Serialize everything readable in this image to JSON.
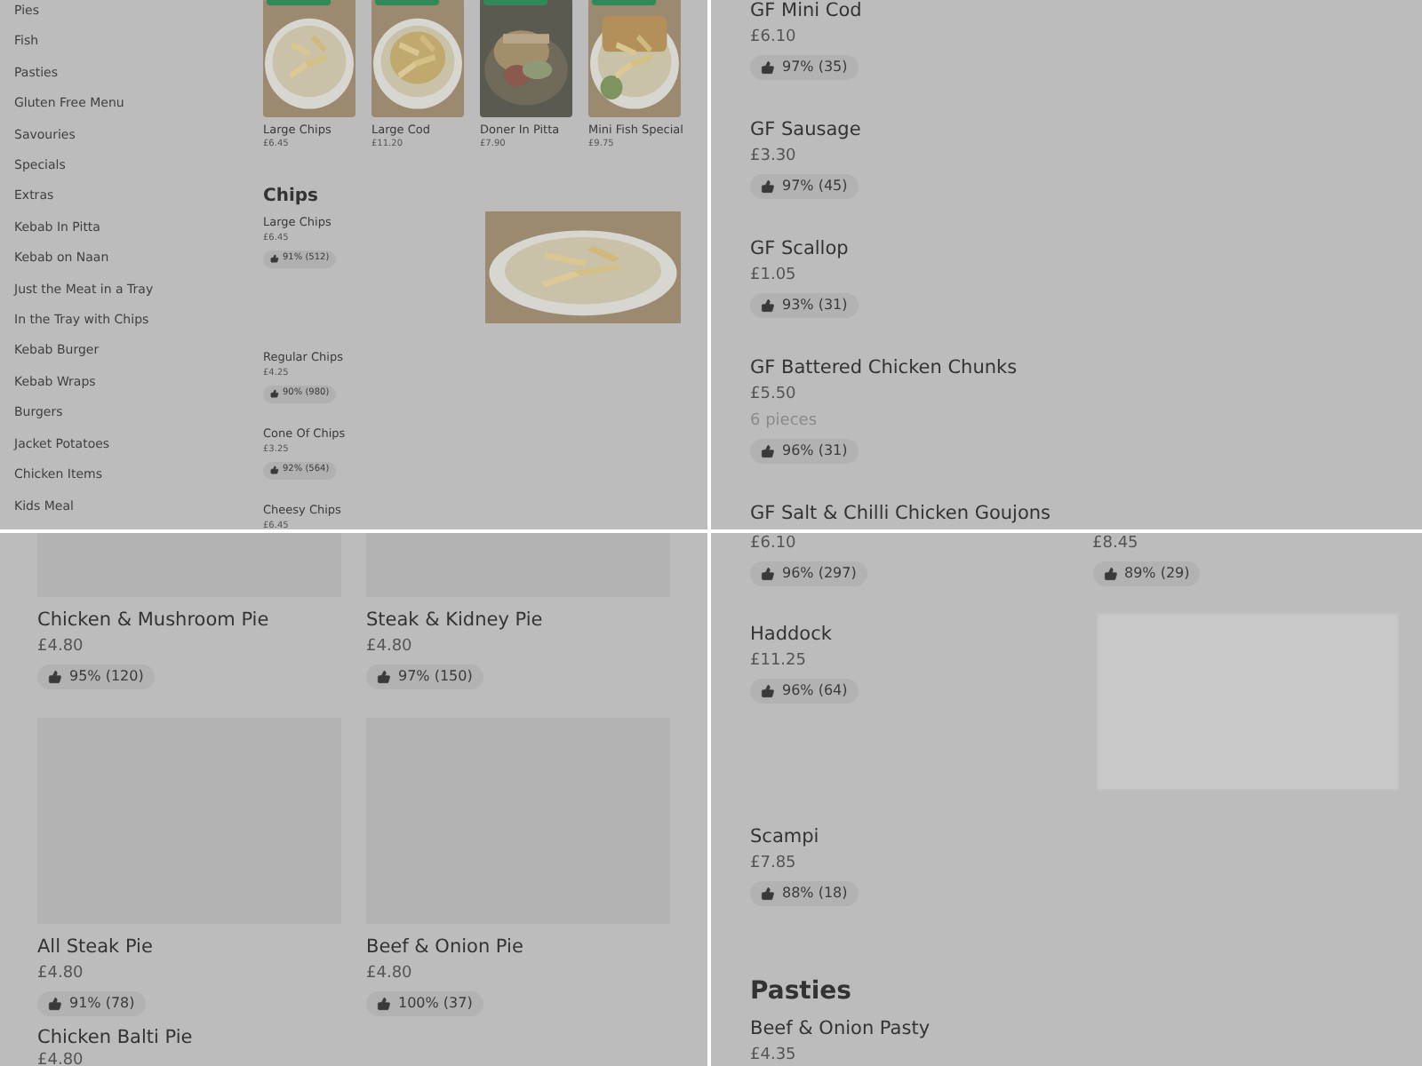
{
  "top_left": {
    "categories": [
      "Pies",
      "Fish",
      "Pasties",
      "Gluten Free Menu",
      "Savouries",
      "Specials",
      "Extras",
      "Kebab In Pitta",
      "Kebab on Naan",
      "Just the Meat in a Tray",
      "In the Tray with Chips",
      "Kebab Burger",
      "Kebab Wraps",
      "Burgers",
      "Jacket Potatoes",
      "Chicken Items",
      "Kids Meal"
    ],
    "featured": [
      {
        "name": "Large Chips",
        "price": "£6.45"
      },
      {
        "name": "Large Cod",
        "price": "£11.20"
      },
      {
        "name": "Doner In Pitta",
        "price": "£7.90"
      },
      {
        "name": "Mini Fish Special",
        "price": "£9.75"
      }
    ],
    "section": {
      "title": "Chips",
      "items": [
        {
          "name": "Large Chips",
          "price": "£6.45",
          "rating": "91% (512)"
        },
        {
          "name": "Regular Chips",
          "price": "£4.25",
          "rating": "90% (980)"
        },
        {
          "name": "Cone Of Chips",
          "price": "£3.25",
          "rating": "92% (564)"
        },
        {
          "name": "Cheesy Chips",
          "price": "£6.45"
        }
      ]
    }
  },
  "top_right": {
    "items": [
      {
        "name": "GF Mini Cod",
        "price": "£6.10",
        "rating": "97% (35)"
      },
      {
        "name": "GF Sausage",
        "price": "£3.30",
        "rating": "97% (45)"
      },
      {
        "name": "GF Scallop",
        "price": "£1.05",
        "rating": "93% (31)"
      },
      {
        "name": "GF Battered Chicken Chunks",
        "price": "£5.50",
        "description": "6 pieces",
        "rating": "96% (31)"
      },
      {
        "name": "GF Salt & Chilli Chicken Goujons"
      }
    ]
  },
  "bottom_left": {
    "items": [
      {
        "name": "Chicken & Mushroom Pie",
        "price": "£4.80",
        "rating": "95% (120)"
      },
      {
        "name": "Steak & Kidney Pie",
        "price": "£4.80",
        "rating": "97% (150)"
      },
      {
        "name": "All Steak Pie",
        "price": "£4.80",
        "rating": "91% (78)"
      },
      {
        "name": "Beef & Onion Pie",
        "price": "£4.80",
        "rating": "100% (37)"
      },
      {
        "name": "Chicken Balti Pie",
        "price": "£4.80"
      }
    ]
  },
  "bottom_right": {
    "top_row": [
      {
        "price": "£6.10",
        "rating": "96% (297)"
      },
      {
        "price": "£8.45",
        "rating": "89% (29)"
      }
    ],
    "items": [
      {
        "name": "Haddock",
        "price": "£11.25",
        "rating": "96% (64)"
      },
      {
        "name": "Scampi",
        "price": "£7.85",
        "rating": "88% (18)"
      }
    ],
    "section": {
      "title": "Pasties",
      "items": [
        {
          "name": "Beef & Onion Pasty",
          "price": "£4.35"
        }
      ]
    }
  }
}
